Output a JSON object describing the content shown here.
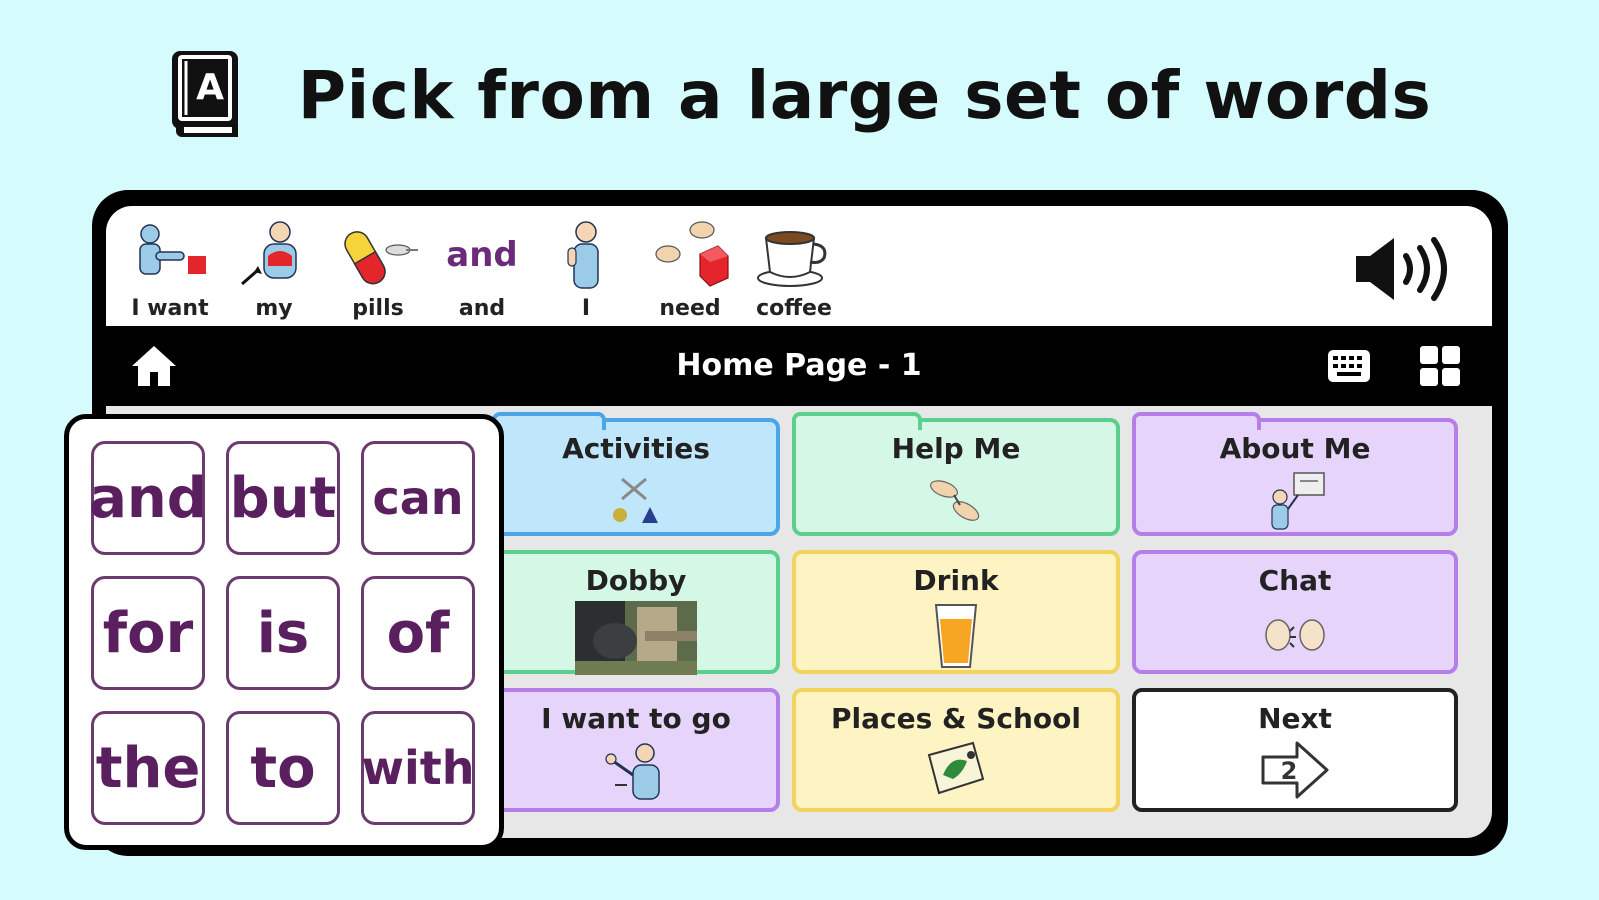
{
  "headline": {
    "text": "Pick from a large set of words",
    "icon": "book-a-icon"
  },
  "message_bar": {
    "words": [
      {
        "label": "I want",
        "icon": "i-want-symbol"
      },
      {
        "label": "my",
        "icon": "my-symbol"
      },
      {
        "label": "pills",
        "icon": "pills-symbol"
      },
      {
        "label": "and",
        "symbol_text": "and"
      },
      {
        "label": "I",
        "icon": "i-symbol"
      },
      {
        "label": "need",
        "icon": "need-symbol"
      },
      {
        "label": "coffee",
        "icon": "coffee-cup-symbol"
      }
    ],
    "speak_icon": "speaker-icon"
  },
  "nav": {
    "title": "Home Page - 1",
    "home_icon": "home-icon",
    "keyboard_icon": "keyboard-icon",
    "grid_icon": "grid-icon"
  },
  "tiles": [
    {
      "label": "Activities",
      "color": "#bfe6fb",
      "border": "#4aa6e8",
      "icon": "activities-symbol"
    },
    {
      "label": "Help Me",
      "color": "#d5f8e6",
      "border": "#5ccf8d",
      "icon": "help-me-symbol"
    },
    {
      "label": "About Me",
      "color": "#e6d4fb",
      "border": "#b57ee8",
      "icon": "about-me-symbol"
    },
    {
      "label": "Dobby",
      "color": "#d5f8e6",
      "border": "#5ccf8d",
      "icon": "dobby-photo"
    },
    {
      "label": "Drink",
      "color": "#fdf3c3",
      "border": "#f3d35b",
      "icon": "drink-glass-symbol"
    },
    {
      "label": "Chat",
      "color": "#e6d4fb",
      "border": "#b57ee8",
      "icon": "chat-symbol"
    },
    {
      "label": "I want to go",
      "color": "#e6d4fb",
      "border": "#b57ee8",
      "icon": "i-want-to-go-symbol"
    },
    {
      "label": "Places & School",
      "color": "#fdf3c3",
      "border": "#f3d35b",
      "icon": "places-map-symbol"
    },
    {
      "label": "Next",
      "color": "#ffffff",
      "border": "#222222",
      "icon": "next-arrow-icon",
      "arrow_number": "2"
    }
  ],
  "core_words": [
    "and",
    "but",
    "can",
    "for",
    "is",
    "of",
    "the",
    "to",
    "with"
  ],
  "colors": {
    "background": "#d6fbfd",
    "core_text": "#5a1f5e",
    "symbol_text": "#6b2a7a"
  }
}
